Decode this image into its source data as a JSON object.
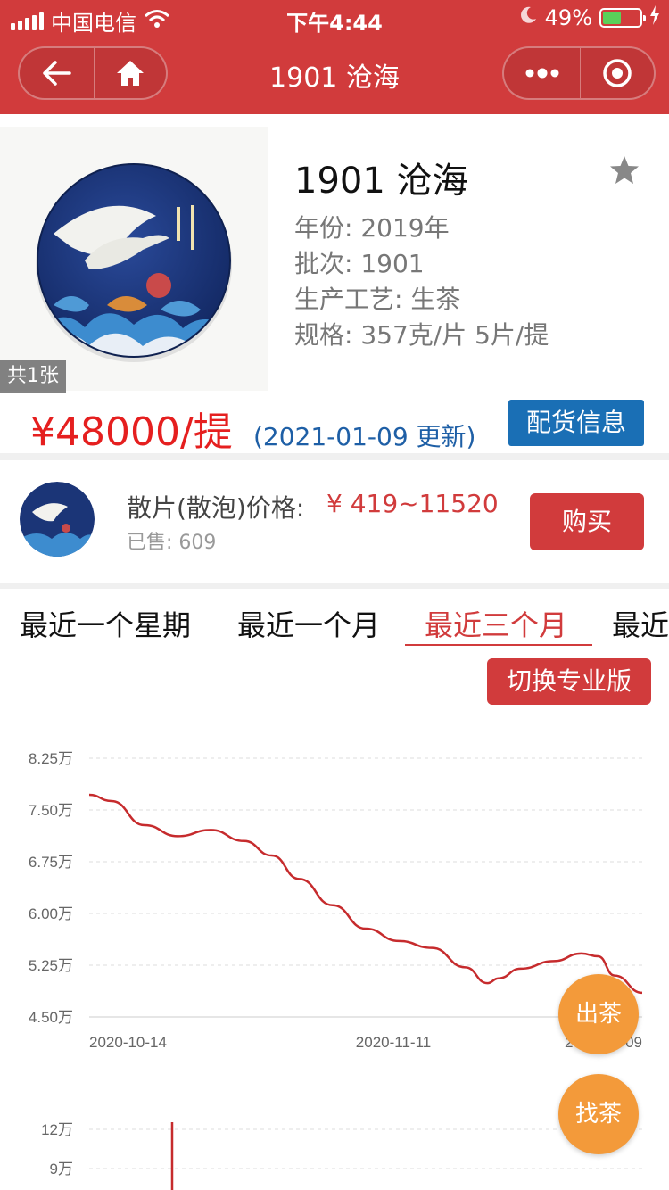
{
  "status_bar": {
    "carrier": "中国电信",
    "time": "下午4:44",
    "battery": "49%",
    "battery_level": 0.49
  },
  "nav": {
    "title": "1901 沧海"
  },
  "product": {
    "title": "1901 沧海",
    "year": "年份: 2019年",
    "batch": "批次: 1901",
    "process": "生产工艺: 生茶",
    "spec": "规格: 357克/片 5片/提",
    "image_count": "共1张",
    "price": "¥48000/提",
    "updated": "(2021-01-09 更新)",
    "distribution_button": "配货信息"
  },
  "loose": {
    "label": "散片(散泡)价格:",
    "price_range": "¥ 419~11520",
    "sold": "已售: 609",
    "buy_button": "购买"
  },
  "tabs": [
    {
      "label": "最近一个星期"
    },
    {
      "label": "最近一个月"
    },
    {
      "label": "最近三个月"
    },
    {
      "label": "最近"
    }
  ],
  "pro_button": "切换专业版",
  "fab": {
    "sell": "出茶",
    "find": "找茶"
  },
  "colors": {
    "brand_red": "#d13b3c",
    "price_red": "#e51f1f",
    "blue": "#1a6fb5",
    "orange": "#f39a3a"
  },
  "chart_data": [
    {
      "type": "line",
      "yticks": [
        "8.25万",
        "7.50万",
        "6.75万",
        "6.00万",
        "5.25万",
        "4.50万"
      ],
      "xticks": [
        "2020-10-14",
        "2020-11-11",
        "2021-01-09"
      ],
      "ylim": [
        4.5,
        8.25
      ],
      "y_unit": "万",
      "grid": true,
      "series": [
        {
          "x": [
            0,
            0.04,
            0.1,
            0.16,
            0.22,
            0.28,
            0.33,
            0.38,
            0.44,
            0.5,
            0.56,
            0.62,
            0.68,
            0.72,
            0.74,
            0.78,
            0.84,
            0.89,
            0.92,
            0.95,
            1.0
          ],
          "values": [
            7.72,
            7.63,
            7.28,
            7.12,
            7.21,
            7.05,
            6.84,
            6.5,
            6.12,
            5.78,
            5.6,
            5.5,
            5.22,
            4.99,
            5.06,
            5.2,
            5.31,
            5.42,
            5.38,
            5.1,
            4.85
          ]
        }
      ]
    },
    {
      "type": "bar",
      "yticks": [
        "12万",
        "9万"
      ],
      "partial": true
    }
  ]
}
